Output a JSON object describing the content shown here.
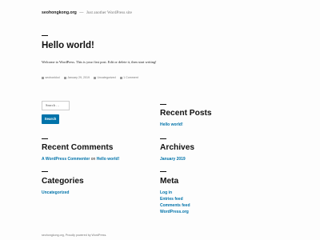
{
  "header": {
    "site_title": "seohongkong.org",
    "separator": "—",
    "site_description": "Just another WordPress site"
  },
  "post": {
    "title": "Hello world!",
    "body": "Welcome to WordPress. This is your first post. Edit or delete it, then start writing!",
    "meta": {
      "author": "seohonkkol",
      "date": "January 29, 2019",
      "category": "Uncategorized",
      "comments": "1 Comment"
    }
  },
  "search": {
    "placeholder": "Search …",
    "button_label": "Search"
  },
  "widgets": {
    "recent_posts": {
      "title": "Recent Posts",
      "items": [
        "Hello world!"
      ]
    },
    "recent_comments": {
      "title": "Recent Comments",
      "author": "A WordPress Commenter",
      "on_text": "on",
      "post": "Hello world!"
    },
    "archives": {
      "title": "Archives",
      "items": [
        "January 2019"
      ]
    },
    "categories": {
      "title": "Categories",
      "items": [
        "Uncategorized"
      ]
    },
    "meta": {
      "title": "Meta",
      "items": [
        "Log in",
        "Entries feed",
        "Comments feed",
        "WordPress.org"
      ]
    }
  },
  "footer": {
    "text": "seohongkong.org, Proudly powered by WordPress."
  },
  "colors": {
    "link": "#0073aa",
    "text": "#1d1d1d",
    "muted": "#767676"
  }
}
